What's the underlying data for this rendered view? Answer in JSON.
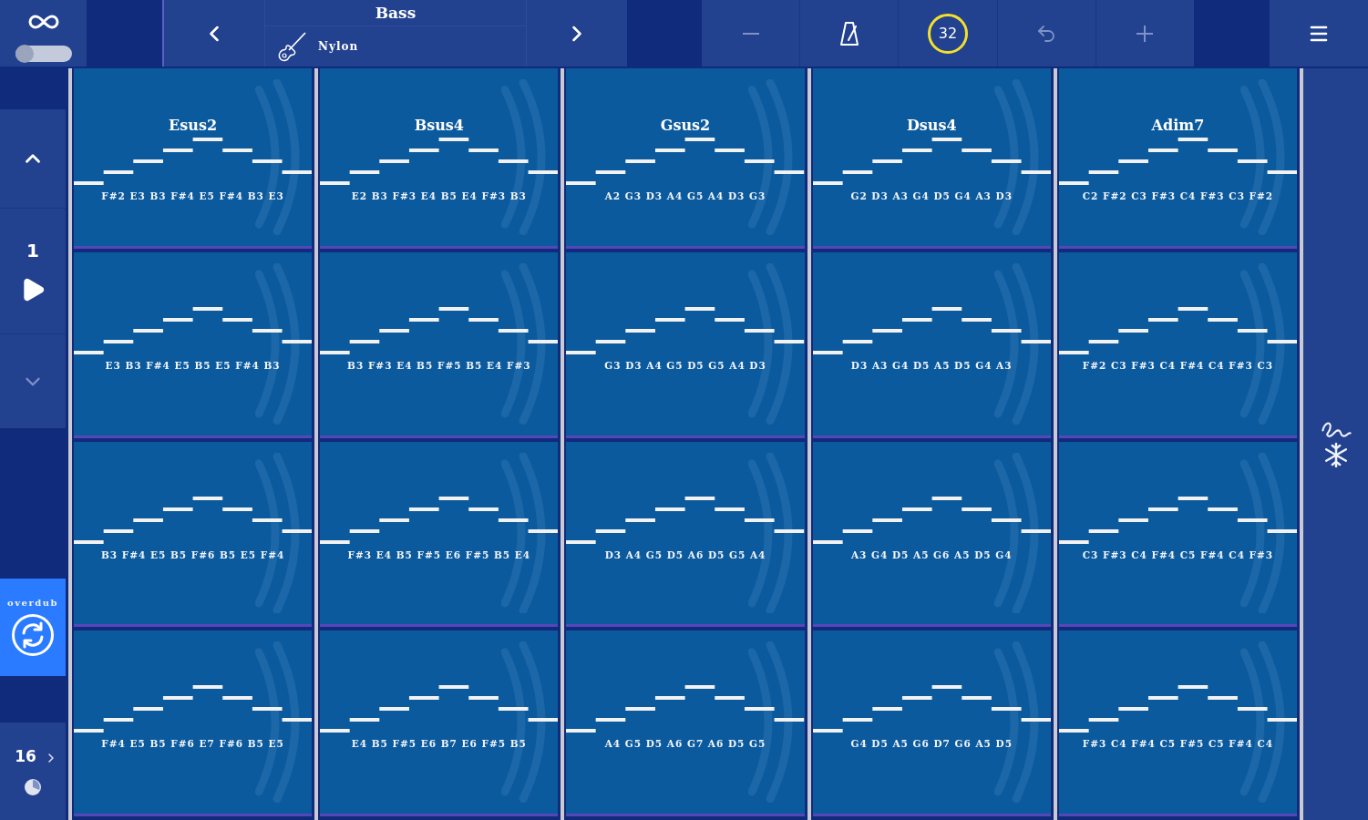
{
  "top_bar": {
    "loop_switch": {
      "on": false
    },
    "instrument": {
      "name": "Bass",
      "preset": "Nylon"
    },
    "toolbar": [
      {
        "kind": "minus",
        "disabled": true
      },
      {
        "kind": "metronome",
        "disabled": false
      },
      {
        "kind": "tempo",
        "label": "32"
      },
      {
        "kind": "undo",
        "disabled": true
      },
      {
        "kind": "plus",
        "disabled": true
      }
    ]
  },
  "left_panel": {
    "pattern": {
      "number": "1",
      "up": {
        "disabled": false
      },
      "down": {
        "disabled": true
      }
    },
    "overdub": {
      "label": "overdub",
      "on": true
    },
    "steps": {
      "count": "16"
    }
  },
  "pads": [
    [
      {
        "chord": "Esus2",
        "notes": "F#2 E3 B3 F#4 E5 F#4 B3 E3"
      },
      {
        "chord": "Bsus4",
        "notes": "E2 B3 F#3 E4 B5 E4 F#3 B3"
      },
      {
        "chord": "Gsus2",
        "notes": "A2 G3 D3 A4 G5 A4 D3 G3"
      },
      {
        "chord": "Dsus4",
        "notes": "G2 D3 A3 G4 D5 G4 A3 D3"
      },
      {
        "chord": "Adim7",
        "notes": "C2 F#2 C3 F#3 C4 F#3 C3 F#2"
      }
    ],
    [
      {
        "notes": "E3 B3 F#4 E5 B5 E5 F#4 B3"
      },
      {
        "notes": "B3 F#3 E4 B5 F#5 B5 E4 F#3"
      },
      {
        "notes": "G3 D3 A4 G5 D5 G5 A4 D3"
      },
      {
        "notes": "D3 A3 G4 D5 A5 D5 G4 A3"
      },
      {
        "notes": "F#2 C3 F#3 C4 F#4 C4 F#3 C3"
      }
    ],
    [
      {
        "notes": "B3 F#4 E5 B5 F#6 B5 E5 F#4"
      },
      {
        "notes": "F#3 E4 B5 F#5 E6 F#5 B5 E4"
      },
      {
        "notes": "D3 A4 G5 D5 A6 D5 G5 A4"
      },
      {
        "notes": "A3 G4 D5 A5 G6 A5 D5 G4"
      },
      {
        "notes": "C3 F#3 C4 F#4 C5 F#4 C4 F#3"
      }
    ],
    [
      {
        "notes": "F#4 E5 B5 F#6 E7 F#6 B5 E5"
      },
      {
        "notes": "E4 B5 F#5 E6 B7 E6 F#5 B5"
      },
      {
        "notes": "A4 G5 D5 A6 G7 A6 D5 G5"
      },
      {
        "notes": "G4 D5 A5 G6 D7 G6 A5 D5"
      },
      {
        "notes": "F#3 C4 F#4 C5 F#5 C5 F#4 C4"
      }
    ]
  ]
}
